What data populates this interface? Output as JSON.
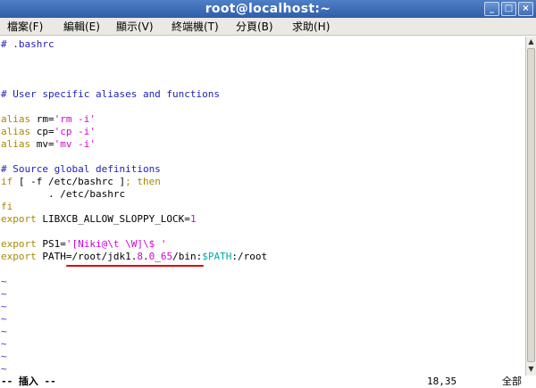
{
  "window": {
    "title": "root@localhost:~",
    "min_glyph": "_",
    "max_glyph": "□",
    "close_glyph": "×"
  },
  "menu": {
    "items": [
      "檔案(F)",
      "編輯(E)",
      "顯示(V)",
      "終端機(T)",
      "分頁(B)",
      "求助(H)"
    ]
  },
  "editor": {
    "lines": {
      "l1": "# .bashrc",
      "l2": "# User specific aliases and functions",
      "l3a_kw": "alias ",
      "l3a_def": "rm=",
      "l3a_str": "'rm -i'",
      "l3b_kw": "alias ",
      "l3b_def": "cp=",
      "l3b_str": "'cp -i'",
      "l3c_kw": "alias ",
      "l3c_def": "mv=",
      "l3c_str": "'mv -i'",
      "l4": "# Source global definitions",
      "l5_kw1": "if",
      "l5_mid": " [ -f /etc/bashrc ]",
      "l5_kw2": "; then",
      "l6": "        . /etc/bashrc",
      "l7": "fi",
      "l8_kw": "export ",
      "l8_def": "LIBXCB_ALLOW_SLOPPY_LOCK=",
      "l8_num": "1",
      "l9_kw": "export ",
      "l9_def": "PS1=",
      "l9_str": "'[Niki@\\t \\W]\\$ '",
      "l10_kw": "export ",
      "l10_def": "PATH=",
      "l10_path": "/root/jdk1.",
      "l10_n1": "8",
      "l10_dot": ".",
      "l10_n2": "0",
      "l10_under": "_",
      "l10_n3": "65",
      "l10_bin": "/bin:",
      "l10_var": "$PATH",
      "l10_end": ":/root"
    },
    "tilde": "~"
  },
  "status": {
    "mode": "-- 插入 --",
    "position": "18,35",
    "scroll": "全部"
  }
}
